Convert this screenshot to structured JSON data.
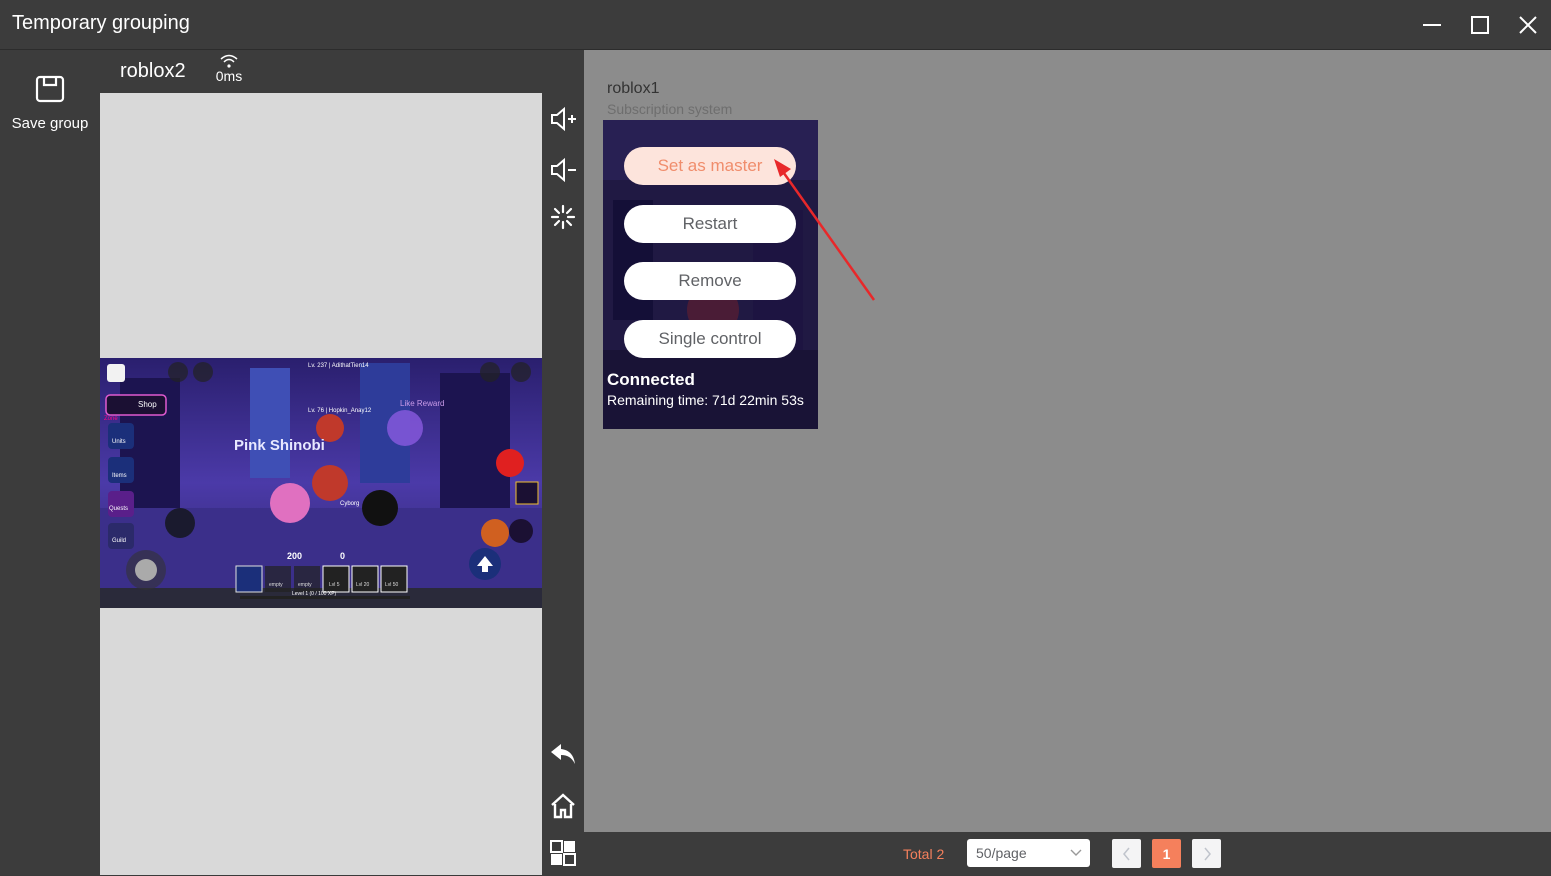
{
  "window": {
    "title": "Temporary grouping",
    "controls": [
      "minimize-icon",
      "maximize-icon",
      "close-icon"
    ]
  },
  "sidebar": {
    "save_group_label": "Save group",
    "save_group_icon": "save-icon"
  },
  "device_panel": {
    "name": "roblox2",
    "latency": "0ms",
    "latency_icon": "wifi-icon",
    "game_overlay": {
      "shop": "Shop",
      "units": "Units",
      "items": "Items",
      "quests": "Quests",
      "guild": "Guild",
      "zone": "Zone",
      "player_banner": "Pink Shinobi",
      "like_reward": "Like Reward",
      "gems": "200",
      "coins": "0",
      "level_bar": "Level 1 (0 / 100 XP)",
      "slot_empty": "empty",
      "lvl_5": "Lvl 5",
      "lvl_20": "Lvl 20",
      "lvl_50": "Lvl 50",
      "top_tag": "Lv. 237 | AdithatTien14",
      "name_tag": "Lv. 76 | Hopkin_Anay12",
      "cyborg": "Cyborg"
    }
  },
  "toolbar": {
    "tools": [
      "volume-up-icon",
      "volume-down-icon",
      "loading-icon",
      "back-icon",
      "home-icon",
      "multitask-icon"
    ]
  },
  "group_list": {
    "cards": [
      {
        "title": "roblox1",
        "subtitle": "Subscription system",
        "menu": [
          "Set as master",
          "Restart",
          "Remove",
          "Single control"
        ],
        "status": "Connected",
        "remaining": "Remaining time: 71d 22min 53s"
      }
    ]
  },
  "pagination": {
    "total": "Total 2",
    "page_size": "50/page",
    "current_page": "1"
  },
  "colors": {
    "accent": "#f5805c",
    "arrow": "#e8282a",
    "panel_dark": "#3c3c3c",
    "content_gray": "#8c8c8c"
  }
}
